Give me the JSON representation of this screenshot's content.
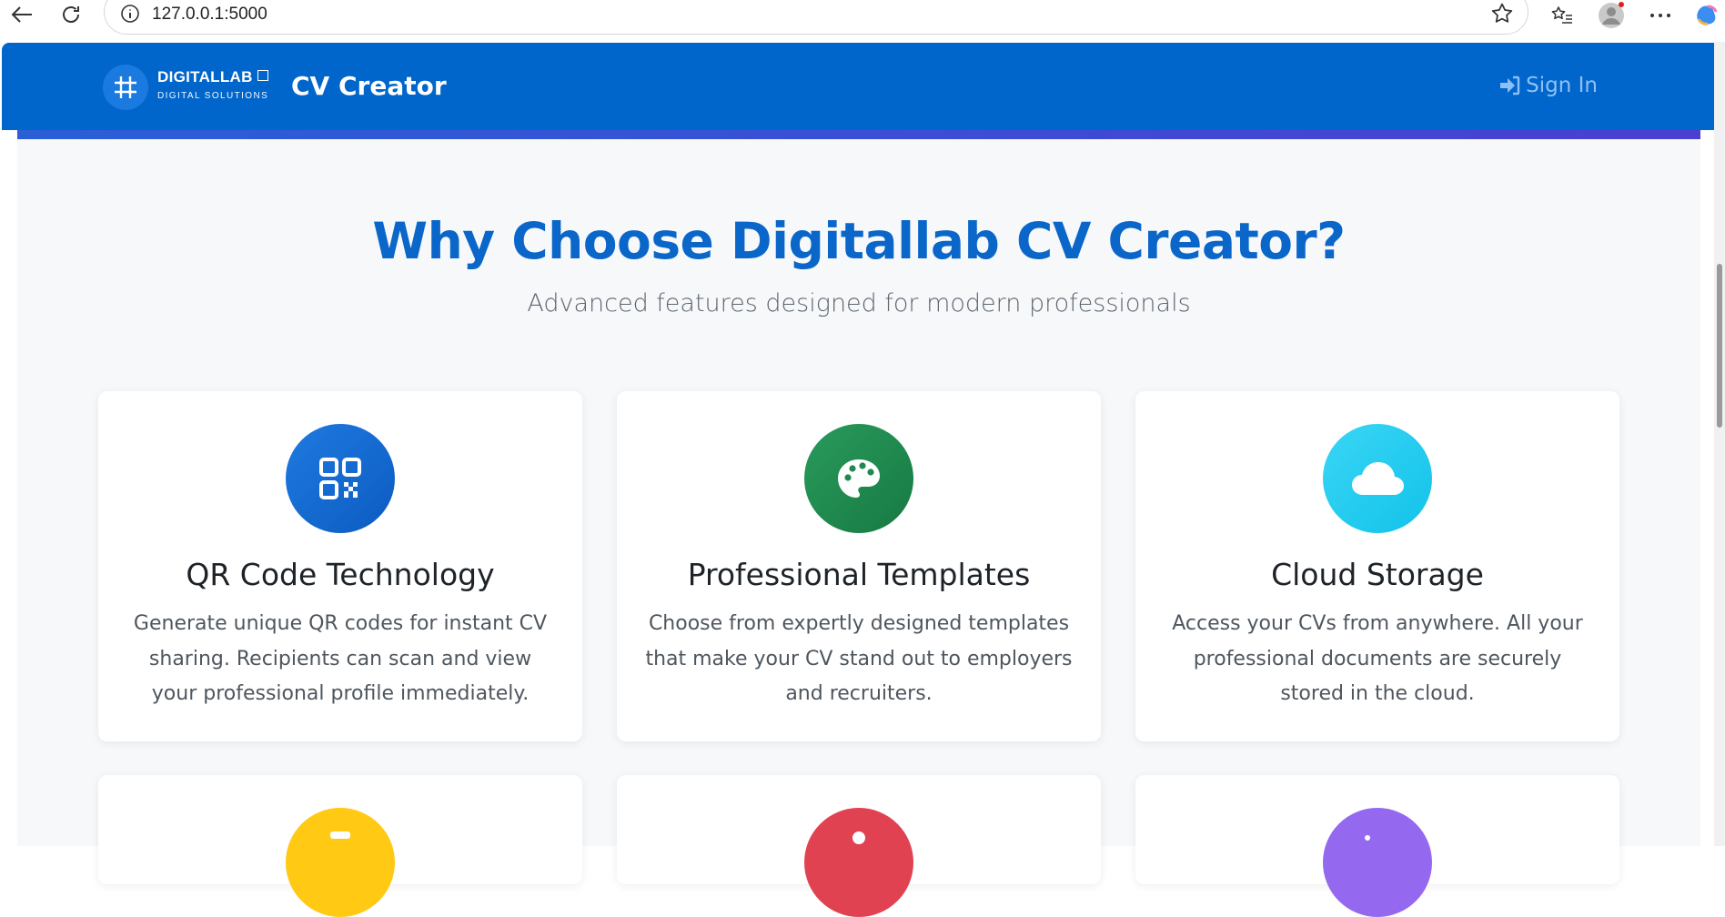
{
  "browser": {
    "url": "127.0.0.1:5000"
  },
  "header": {
    "logo_name": "DIGITALLAB",
    "logo_tagline": "DIGITAL SOLUTIONS",
    "app_title": "CV Creator",
    "sign_in_label": "Sign In"
  },
  "hero": {
    "title": "Why Choose Digitallab CV Creator?",
    "subtitle": "Advanced features designed for modern professionals"
  },
  "features": [
    {
      "title": "QR Code Technology",
      "desc": "Generate unique QR codes for instant CV sharing. Recipients can scan and view your professional profile immediately.",
      "icon": "qrcode-icon",
      "color": "#1166cf"
    },
    {
      "title": "Professional Templates",
      "desc": "Choose from expertly designed templates that make your CV stand out to employers and recruiters.",
      "icon": "palette-icon",
      "color": "#1e8a4f"
    },
    {
      "title": "Cloud Storage",
      "desc": "Access your CVs from anywhere. All your professional documents are securely stored in the cloud.",
      "icon": "cloud-icon",
      "color": "#1ccbee"
    }
  ],
  "features_row2_colors": [
    "#ffc914",
    "#e04252",
    "#9469f0"
  ],
  "colors": {
    "header_bg": "#0066cc",
    "heading": "#0a66c9",
    "page_bg": "#f6f8fa"
  }
}
